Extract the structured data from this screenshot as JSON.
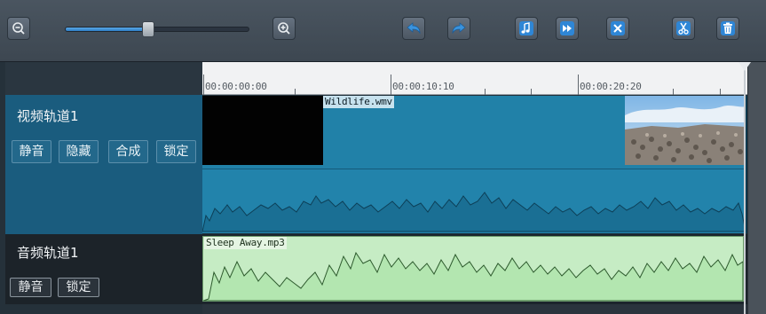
{
  "toolbar": {
    "zoom_level": 0.45,
    "buttons": [
      {
        "name": "zoom-out",
        "icon": "zoom-out-icon"
      },
      {
        "name": "zoom-in",
        "icon": "zoom-in-icon"
      },
      {
        "name": "undo",
        "icon": "undo-arrow-icon"
      },
      {
        "name": "redo",
        "icon": "redo-arrow-icon"
      },
      {
        "name": "add-music",
        "icon": "music-note-icon"
      },
      {
        "name": "fast-forward",
        "icon": "fast-forward-icon"
      },
      {
        "name": "close",
        "icon": "close-x-icon"
      },
      {
        "name": "cut",
        "icon": "scissors-icon"
      },
      {
        "name": "delete",
        "icon": "trash-icon"
      }
    ],
    "colors": {
      "accent_blue": "#2e86d6"
    }
  },
  "ruler": {
    "labels": [
      "00:00:00:00",
      "00:00:10:10",
      "00:00:20:20"
    ]
  },
  "video_track": {
    "name": "视频轨道1",
    "buttons": [
      "静音",
      "隐藏",
      "合成",
      "锁定"
    ],
    "clip": {
      "title": "Wildlife.wmv",
      "color": "#2181a8"
    }
  },
  "audio_track": {
    "name": "音频轨道1",
    "buttons": [
      "静音",
      "锁定"
    ],
    "clip": {
      "title": "Sleep Away.mp3",
      "color": "#c6ecc4"
    }
  }
}
